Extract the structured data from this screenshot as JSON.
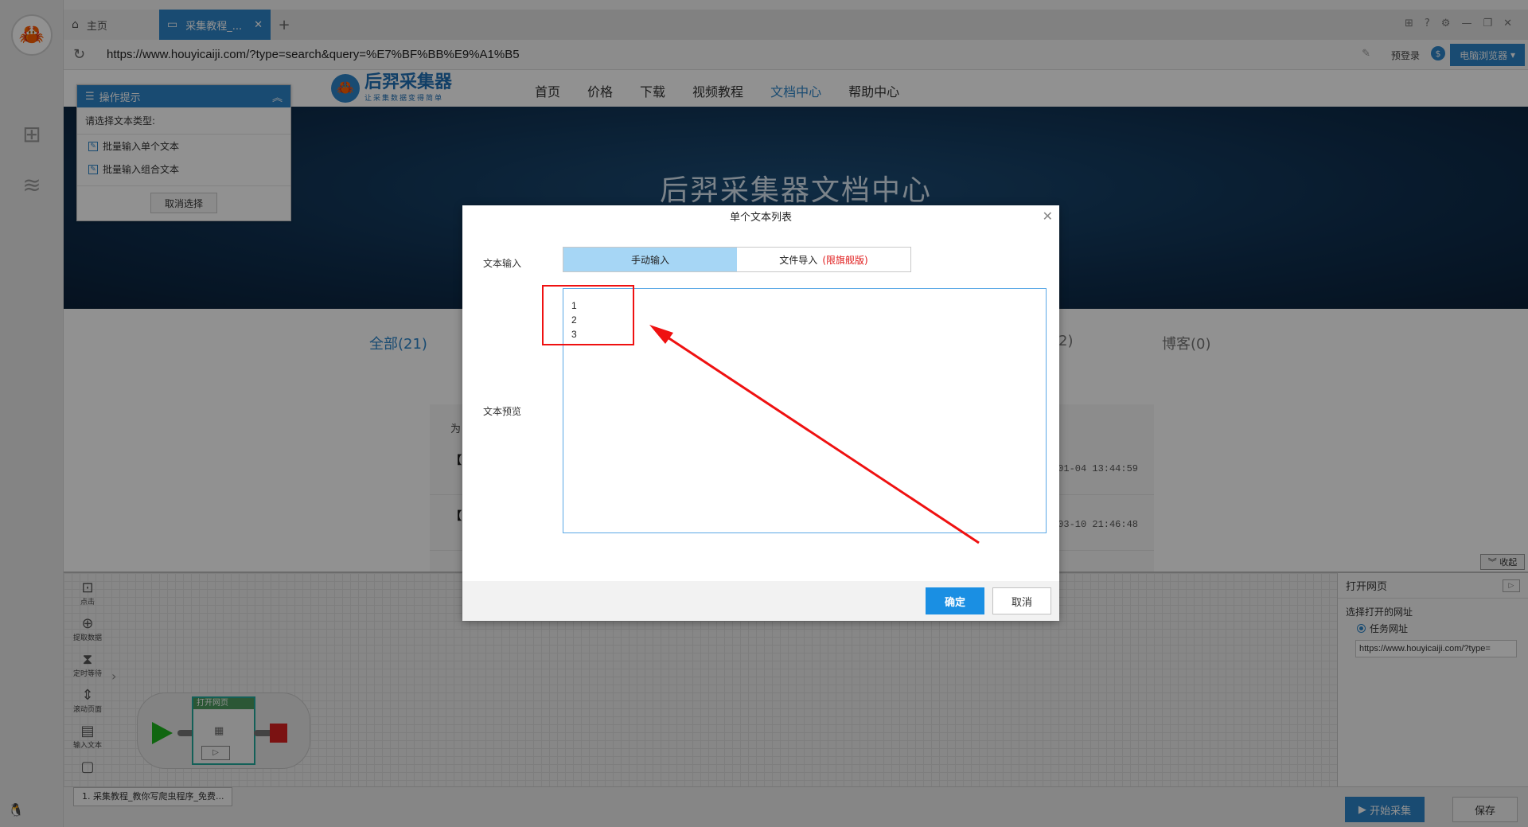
{
  "browser": {
    "tabs": [
      {
        "label": "主页"
      },
      {
        "label": "采集教程_..."
      }
    ],
    "new_tab": "+",
    "address": "https://www.houyicaiji.com/?type=search&query=%E7%BF%BB%E9%A1%B5",
    "prelogin": "预登录",
    "browser_button": "电脑浏览器",
    "window_controls": [
      "⊞",
      "?",
      "⚙",
      "—",
      "❐",
      "✕"
    ]
  },
  "site": {
    "logo_name": "后羿采集器",
    "logo_slogan": "让采集数据变得简单",
    "nav": [
      "首页",
      "价格",
      "下载",
      "视频教程",
      "文档中心",
      "帮助中心"
    ],
    "hero_title": "后羿采集器文档中心",
    "categories": {
      "all": "全部(21)",
      "partial": "2)",
      "blog": "博客(0)"
    },
    "articles": [
      {
        "lead": "为",
        "head": "【",
        "date": "-01-04 13:44:59"
      },
      {
        "head": "【",
        "date": "-03-10 21:46:48"
      }
    ]
  },
  "hint_panel": {
    "title": "操作提示",
    "question": "请选择文本类型:",
    "options": [
      "批量输入单个文本",
      "批量输入组合文本"
    ],
    "cancel": "取消选择"
  },
  "workflow": {
    "tools": [
      "点击",
      "提取数据",
      "定时等待",
      "滚动页面",
      "输入文本"
    ],
    "node_label": "打开网页",
    "collapse": "收起"
  },
  "props": {
    "title": "打开网页",
    "label": "选择打开的网址",
    "radio": "任务网址",
    "url": "https://www.houyicaiji.com/?type="
  },
  "statusbar": {
    "task": "1. 采集教程_教你写爬虫程序_免费...",
    "start": "开始采集",
    "save": "保存"
  },
  "dialog": {
    "title": "单个文本列表",
    "input_label": "文本输入",
    "tab_manual": "手动输入",
    "tab_file": "文件导入",
    "tab_file_note": "(限旗舰版)",
    "preview_label": "文本预览",
    "lines": [
      "1",
      "2",
      "3"
    ],
    "ok": "确定",
    "cancel": "取消"
  },
  "colors": {
    "accent": "#2d84c8",
    "annotation": "#ef1111",
    "ok_button": "#1a8fe3"
  }
}
